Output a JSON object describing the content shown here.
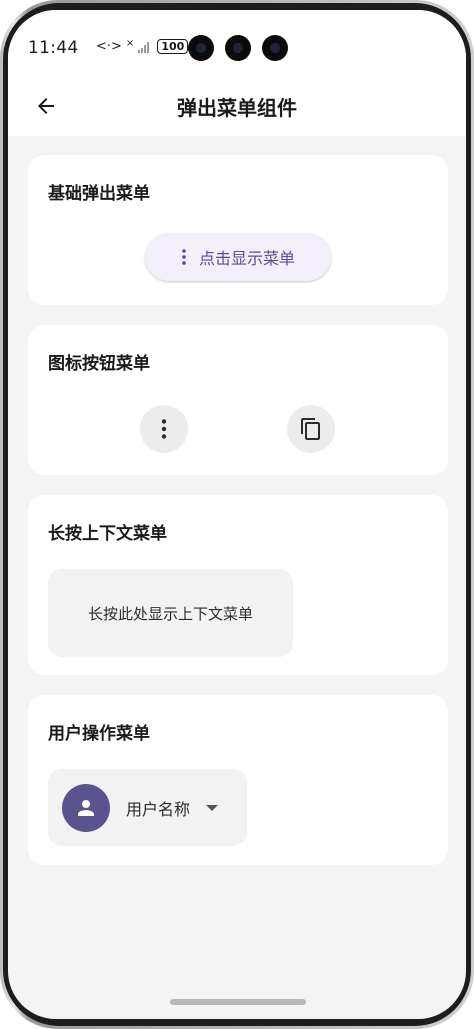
{
  "status_bar": {
    "time": "11:44",
    "network_glyph": "<·>",
    "signal_mark": "×",
    "battery": "100"
  },
  "app_bar": {
    "title": "弹出菜单组件"
  },
  "cards": {
    "basic": {
      "title": "基础弹出菜单",
      "button_label": "点击显示菜单"
    },
    "icon": {
      "title": "图标按钮菜单"
    },
    "context": {
      "title": "长按上下文菜单",
      "area_label": "长按此处显示上下文菜单"
    },
    "user": {
      "title": "用户操作菜单",
      "user_name": "用户名称"
    }
  },
  "icons": {
    "back": "arrow-back-icon",
    "more": "more-vert-icon",
    "copy": "copy-icon",
    "person": "person-icon",
    "dropdown": "arrow-drop-down-icon"
  },
  "colors": {
    "accent": "#5b5390",
    "pill_bg": "#f2eefa",
    "pill_text": "#5a4d8c",
    "background": "#f4f4f5",
    "card": "#ffffff"
  }
}
